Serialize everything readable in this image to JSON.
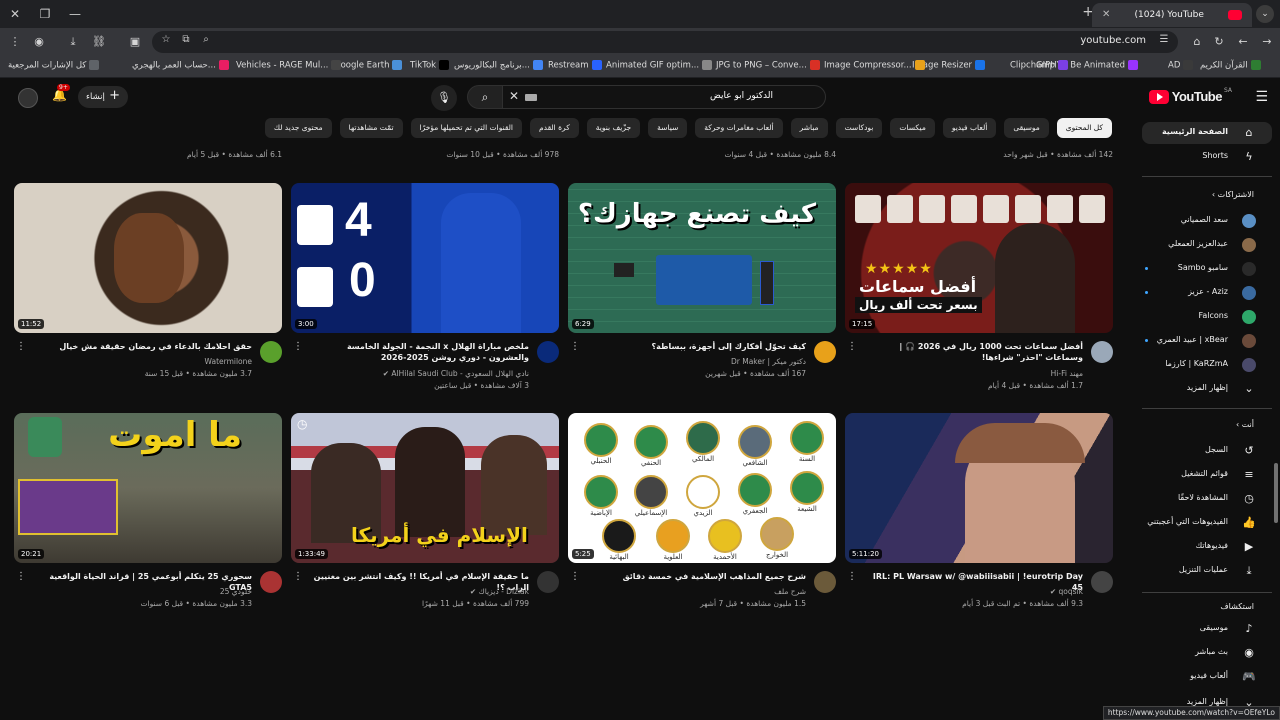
{
  "browser": {
    "tab_title": "(1024) YouTube",
    "url": "youtube.com",
    "status_url": "https://www.youtube.com/watch?v=OEfeYLo",
    "bookmarks": [
      {
        "label": "القرآن الكريم",
        "color": "#2e7d32"
      },
      {
        "label": "AD",
        "color": "#3a3a3a"
      },
      {
        "label": "GIPHY - Be Animated",
        "color": "#9933ff"
      },
      {
        "label": "Clipchamp",
        "color": "#7b3fe4"
      },
      {
        "label": "Image Resizer",
        "color": "#1a73e8"
      },
      {
        "label": "Image Compressor...",
        "color": "#e8a11a"
      },
      {
        "label": "JPG to PNG – Conve...",
        "color": "#d93025"
      },
      {
        "label": "Animated GIF optim...",
        "color": "#888888"
      },
      {
        "label": "Restream",
        "color": "#2962ff"
      },
      {
        "label": "برنامج البكالوريوس...",
        "color": "#4285f4"
      },
      {
        "label": "TikTok",
        "color": "#000000"
      },
      {
        "label": "Google Earth",
        "color": "#4a90d9"
      },
      {
        "label": "Vehicles - RAGE Mul...",
        "color": "#444444"
      },
      {
        "label": "حساب العمر بالهجري...",
        "color": "#e91e63"
      },
      {
        "label": "كل الإشارات المرجعية",
        "color": "#5f6368"
      }
    ]
  },
  "header": {
    "logo_text": "YouTube",
    "country": "SA",
    "search_query": "الدكتور ابو عايض",
    "create_label": "إنشاء",
    "notif_count": "9+"
  },
  "chips": [
    "كل المحتوى",
    "موسيقى",
    "ألعاب فيديو",
    "ميكسات",
    "بودكاست",
    "مباشر",
    "ألعاب مغامرات وحركة",
    "سياسة",
    "جزّيف بنوية",
    "كرة القدم",
    "القنوات التي تم تحميلها مؤخرًا",
    "تمّت مشاهدتها",
    "محتوى جديد لك"
  ],
  "sidebar": {
    "home": "الصفحة الرئيسية",
    "shorts": "Shorts",
    "subs_head": "الاشتراكات",
    "subs": [
      {
        "label": "سعد الصمياني",
        "color": "#5a8fc4",
        "dot": false
      },
      {
        "label": "عبدالعزيز العمعلي",
        "color": "#8a6a4a",
        "dot": false
      },
      {
        "label": "سامبو Sambo",
        "color": "#2a2a2a",
        "dot": true
      },
      {
        "label": "Aziz - عزيز",
        "color": "#3a6aa0",
        "dot": true
      },
      {
        "label": "Falcons",
        "color": "#2ea86a",
        "dot": false
      },
      {
        "label": "xBear | عبيد العمري",
        "color": "#6a4a3a",
        "dot": true
      },
      {
        "label": "KaRZmA | كارزما",
        "color": "#4a4a6a",
        "dot": false
      }
    ],
    "show_more": "إظهار المزيد",
    "you_head": "أنت",
    "you_items": [
      {
        "label": "السجل",
        "icon": "history-icon",
        "glyph": "↺"
      },
      {
        "label": "قوائم التشغيل",
        "icon": "playlist-icon",
        "glyph": "≡"
      },
      {
        "label": "المشاهدة لاحقًا",
        "icon": "clock-icon",
        "glyph": "◷"
      },
      {
        "label": "الفيديوهات التي أعجبتني",
        "icon": "thumbs-up-icon",
        "glyph": "👍"
      },
      {
        "label": "فيديوهاتك",
        "icon": "video-icon",
        "glyph": "▶"
      },
      {
        "label": "عمليات التنزيل",
        "icon": "download-icon",
        "glyph": "⤓"
      }
    ],
    "explore_head": "استكشاف",
    "explore_items": [
      {
        "label": "موسيقى",
        "icon": "music-icon",
        "glyph": "♪"
      },
      {
        "label": "بث مباشر",
        "icon": "live-icon",
        "glyph": "◉"
      },
      {
        "label": "ألعاب فيديو",
        "icon": "gaming-icon",
        "glyph": "🎮"
      }
    ],
    "show_more_2": "إظهار المزيد"
  },
  "partial_row": [
    "6.1 ألف مشاهدة • قبل 5 أيام",
    "978 ألف مشاهدة • قبل 10 سنوات",
    "8.4 مليون مشاهدة • قبل 4 سنوات",
    "142 ألف مشاهدة • قبل شهر واحد"
  ],
  "videos": [
    {
      "title": "حقق احلامك بالدعاء في رمضان حقيقة مش خيال",
      "channel": "Watermilone",
      "meta": "3.7 مليون مشاهدة • قبل 15 سنة",
      "duration": "11:52",
      "avatar": "#5aa02c",
      "verified": false
    },
    {
      "title": "ملخص مباراة الهلال x النجمة - الجولة الخامسة والعشرون - دوري روشن 2025-2026",
      "channel": "نادي الهلال السعودي - AlHilal Saudi Club",
      "meta": "3 آلاف مشاهدة • قبل ساعتين",
      "duration": "3:00",
      "avatar": "#0a2a7a",
      "verified": true
    },
    {
      "title": "كيف تحوّل أفكارك إلى أجهزة، ببساطة؟",
      "channel": "دكتور ميكر | Dr Maker",
      "meta": "167 ألف مشاهدة • قبل شهرين",
      "duration": "6:29",
      "avatar": "#e8a11a",
      "verified": false
    },
    {
      "title": "أفضل سماعات تحت 1000 ريال في 2026 🎧 | وسماعات \"احذر\" شراءها!",
      "channel": "مهند Hi-Fi",
      "meta": "1.7 ألف مشاهدة • قبل 4 أيام",
      "duration": "17:15",
      "avatar": "#9aa8b8",
      "verified": false
    },
    {
      "title": "سحوري 25 يتكلم أبوعمي 25 | قراند الحياة الواقعية GTA5",
      "channel": "خلودي 25",
      "meta": "3.3 مليون مشاهدة • قبل 6 سنوات",
      "duration": "20:21",
      "avatar": "#aa3333",
      "verified": false
    },
    {
      "title": "ما حقيقة الإسلام في أمريكا !! وكيف انتشر بين مغنيين الراب ؟!",
      "channel": "Diziak - ديزياك",
      "meta": "799 ألف مشاهدة • قبل 11 شهرًا",
      "duration": "1:33:49",
      "avatar": "#333333",
      "verified": true
    },
    {
      "title": "شرح جميع المذاهب الإسلامية في خمسة دقائق",
      "channel": "شرح ملف",
      "meta": "1.5 مليون مشاهدة • قبل 7 أشهر",
      "duration": "5:25",
      "avatar": "#6b5a3a",
      "verified": false
    },
    {
      "title": "IRL: PL Warsaw w/ @wabiiisabii | !eurotrip Day 45",
      "channel": "qoqsik",
      "meta": "9.3 ألف مشاهدة • تم البث قبل 3 أيام",
      "duration": "5:11:20",
      "avatar": "#444444",
      "verified": true
    }
  ],
  "thumb_text": {
    "alhilal_score_top": "4",
    "alhilal_score_bottom": "0",
    "maker_title": "كيف تصنع جهازك؟",
    "hifi_line1": "أفضل سماعات",
    "hifi_line2": "بسعر تحت ألف ريال",
    "gta_title": "ما اموت",
    "islam_title": "الإسلام في أمريكا",
    "sects": [
      "السنة",
      "الشافعي",
      "المالكي",
      "الحنفي",
      "الحنبلي",
      "الشيعة",
      "الجعفري",
      "الزيدي",
      "الإسماعيلي",
      "الإباضية",
      "الخوارج",
      "الأحمدية",
      "العلوية",
      "البهائية"
    ]
  }
}
